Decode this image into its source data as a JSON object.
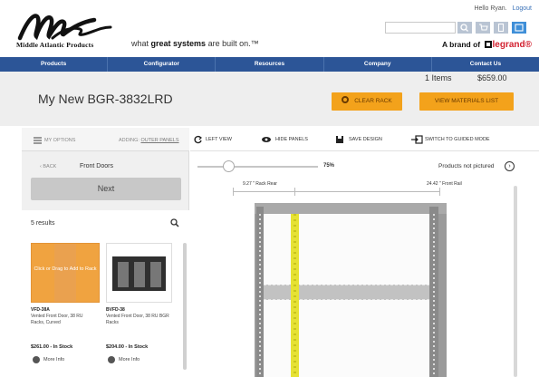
{
  "header": {
    "brand_name": "Middle Atlantic Products",
    "tagline_pre": "what ",
    "tagline_bold": "great systems",
    "tagline_post": " are built on.™",
    "greeting": "Hello Ryan.",
    "logout": "Logout",
    "brand_of_prefix": "A brand of",
    "brand_of_name": "legrand®",
    "icons": [
      "search-icon",
      "cart-icon",
      "document-icon",
      "user-icon"
    ]
  },
  "nav": {
    "items": [
      "Products",
      "Configurator",
      "Resources",
      "Company",
      "Contact Us"
    ]
  },
  "summary": {
    "items": "1 Items",
    "price": "$659.00",
    "title": "My New BGR-3832LRD",
    "clear_rack": "CLEAR RACK",
    "view_materials": "VIEW MATERIALS LIST"
  },
  "left_panel": {
    "my_options": "MY OPTIONS",
    "adding_label": "ADDING:",
    "adding_value": "OUTER PANELS",
    "back": "‹ BACK",
    "section": "Front Doors",
    "next": "Next",
    "results": "5 results",
    "products": [
      {
        "overlay": "Click or Drag to Add to Rack",
        "name": "VFD-38A",
        "desc": "Vented Front Door, 38 RU Racks, Curved",
        "price": "$261.00 - In Stock",
        "info": "More Info"
      },
      {
        "name": "BVFD-38",
        "desc": "Vented Front Door, 38 RU BGR Racks",
        "price": "$204.00 - In Stock",
        "info": "More Info"
      }
    ]
  },
  "viewer": {
    "left_view": "LEFT VIEW",
    "hide_panels": "HIDE PANELS",
    "save_design": "SAVE DESIGN",
    "guided_mode": "SWITCH TO GUIDED MODE",
    "zoom": "75%",
    "not_pictured": "Products not pictured",
    "measure_rear": "9.27 \" Rack Rear",
    "measure_front": "24.42 \" Front Rail"
  },
  "colors": {
    "nav_bg": "#2c5597",
    "accent_orange": "#f3a21b",
    "rail_yellow": "#e6e234",
    "legrand_red": "#d2202f"
  }
}
